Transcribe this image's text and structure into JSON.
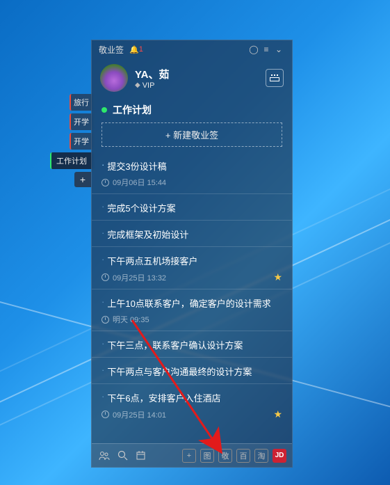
{
  "titlebar": {
    "app_name": "敬业签",
    "notif_count": "1"
  },
  "profile": {
    "username": "YA、茹",
    "vip_label": "VIP"
  },
  "side_tabs": [
    {
      "label": "旅行",
      "cls": "red"
    },
    {
      "label": "开学",
      "cls": "red"
    },
    {
      "label": "开学",
      "cls": "red"
    },
    {
      "label": "工作计划",
      "cls": "grn active"
    }
  ],
  "section": {
    "title": "工作计划",
    "new_button": "+ 新建敬业签"
  },
  "items": [
    {
      "title": "提交3份设计稿",
      "time": "09月06日 15:44",
      "star": false,
      "fade": false
    },
    {
      "title": "完成5个设计方案",
      "time": "",
      "star": false,
      "fade": true
    },
    {
      "title": "完成框架及初始设计",
      "time": "",
      "star": false,
      "fade": true
    },
    {
      "title": "下午两点五机场接客户",
      "time": "09月25日 13:32",
      "star": true,
      "fade": true
    },
    {
      "title": "上午10点联系客户，确定客户的设计需求",
      "time": "明天 09:35",
      "star": false,
      "fade": true
    },
    {
      "title": "下午三点，联系客户确认设计方案",
      "time": "",
      "star": false,
      "fade": true
    },
    {
      "title": "下午两点与客户沟通最终的设计方案",
      "time": "",
      "star": false,
      "fade": true
    },
    {
      "title": "下午6点，安排客户入住酒店",
      "time": "09月25日 14:01",
      "star": true,
      "fade": true
    }
  ],
  "bottombar": {
    "sq_labels": [
      "图",
      "敬",
      "百",
      "淘",
      "JD"
    ]
  }
}
